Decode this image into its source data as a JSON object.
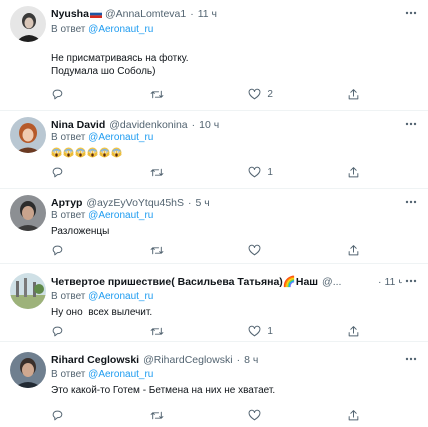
{
  "tweets": [
    {
      "name": "Nyusha",
      "has_flag": true,
      "handle": "@AnnaLomteva1",
      "sep": "·",
      "time": "11 ч",
      "reply_prefix": "В ответ",
      "reply_to": "@Aeronaut_ru",
      "text": "Не присматриваясь на фотку.\nПодумала шо Соболь)",
      "likes": "2",
      "avatar_icon": "avatar-photo"
    },
    {
      "name": "Nina David",
      "handle": "@davidenkonina",
      "sep": "·",
      "time": "10 ч",
      "reply_prefix": "В ответ",
      "reply_to": "@Aeronaut_ru",
      "emoji_count": 6,
      "emoji_name": "scream-emoji",
      "likes": "1",
      "avatar_icon": "avatar-photo"
    },
    {
      "name": "Артур",
      "handle": "@ayzEyVoYtqu45hS",
      "sep": "·",
      "time": "5 ч",
      "reply_prefix": "В ответ",
      "reply_to": "@Aeronaut_ru",
      "text": "Разложенцы",
      "likes": "",
      "avatar_icon": "avatar-photo"
    },
    {
      "name": "Четвертое пришествие( Васильева Татьяна)🌈Наш",
      "handle": "@...",
      "sep": "·",
      "time": "11 ч",
      "reply_prefix": "В ответ",
      "reply_to": "@Aeronaut_ru",
      "text": "Ну оно  всех вылечит.",
      "likes": "1",
      "avatar_icon": "avatar-photo"
    },
    {
      "name": "Rihard Ceglowski",
      "handle": "@RihardCeglowski",
      "sep": "·",
      "time": "8 ч",
      "reply_prefix": "В ответ",
      "reply_to": "@Aeronaut_ru",
      "text": "Это какой-то Готем - Бетмена на них не хватает.",
      "avatar_icon": "avatar-photo"
    }
  ],
  "icons": {
    "more": "more-icon",
    "reply": "reply-icon",
    "retweet": "retweet-icon",
    "like": "like-icon",
    "share": "share-icon"
  },
  "colors": {
    "text": "#0f1419",
    "muted": "#536471",
    "link": "#1d9bf0"
  }
}
